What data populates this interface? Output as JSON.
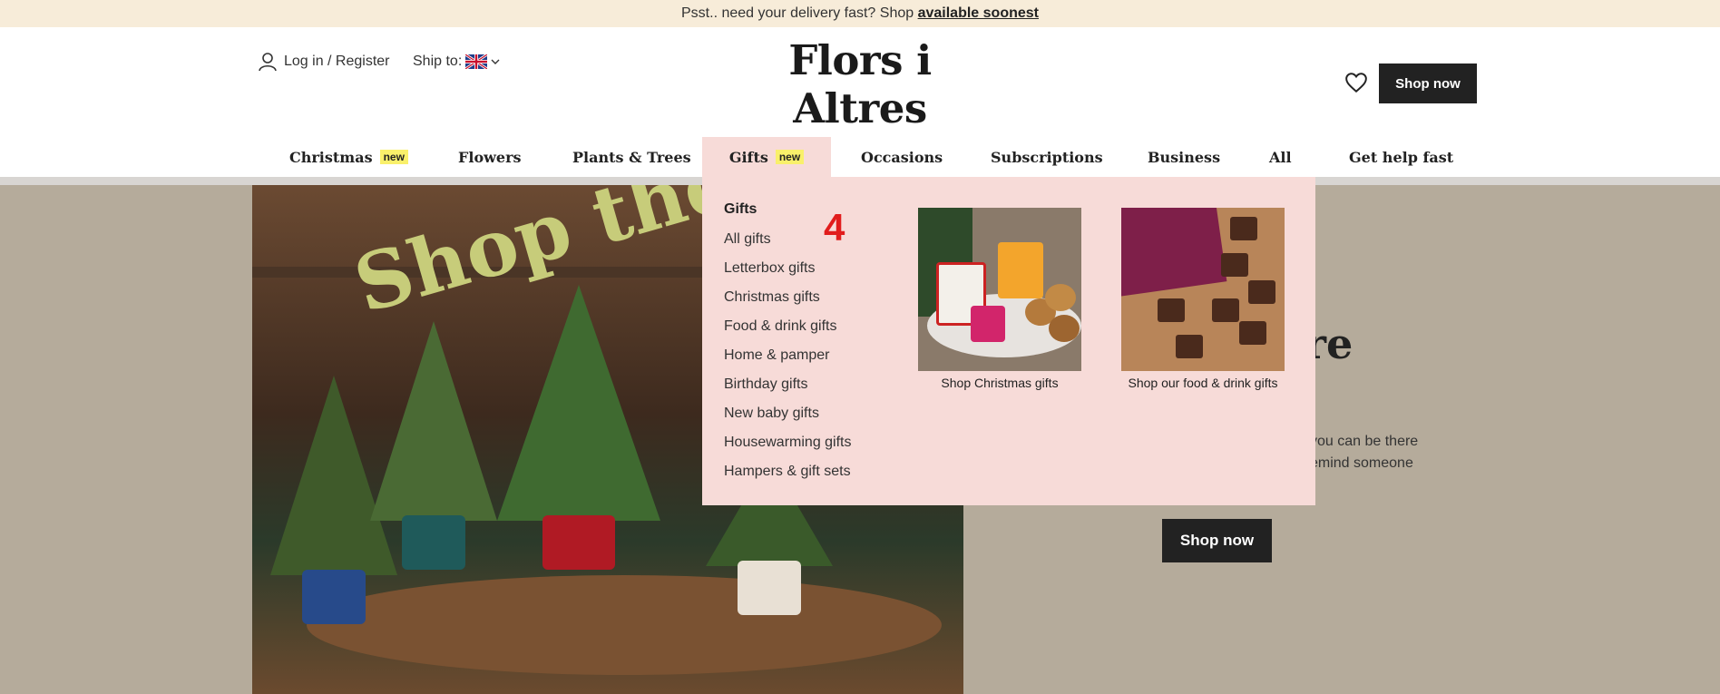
{
  "promo": {
    "text": "Psst.. need your delivery fast? Shop ",
    "link": "available soonest"
  },
  "header": {
    "account_label": "Log in / Register",
    "ship_label": "Ship to:",
    "logo": "Flors i Altres",
    "cta_label": "Shop now"
  },
  "nav": {
    "items": [
      {
        "label": "Christmas",
        "badge": "new"
      },
      {
        "label": "Flowers",
        "badge": ""
      },
      {
        "label": "Plants & Trees",
        "badge": ""
      },
      {
        "label": "Gifts",
        "badge": "new",
        "active": true
      },
      {
        "label": "Occasions",
        "badge": ""
      },
      {
        "label": "Subscriptions",
        "badge": ""
      },
      {
        "label": "Business",
        "badge": ""
      },
      {
        "label": "All",
        "badge": ""
      },
      {
        "label": "Get help fast",
        "badge": ""
      }
    ]
  },
  "dropdown": {
    "heading": "Gifts",
    "marker": "4",
    "links": [
      "All gifts",
      "Letterbox gifts",
      "Christmas gifts",
      "Food & drink gifts",
      "Home & pamper",
      "Birthday gifts",
      "New baby gifts",
      "Housewarming gifts",
      "Hampers & gift sets"
    ],
    "cards": [
      {
        "caption": "Shop Christmas gifts"
      },
      {
        "caption": "Shop our food & drink gifts"
      }
    ]
  },
  "hero": {
    "image_text": "Shop the",
    "title_fragment": "are",
    "desc_line_1": "you can be there",
    "desc_line_2": "emind someone",
    "cta_label": "Shop now"
  },
  "colors": {
    "promo_bg": "#f7ecd9",
    "dropdown_bg": "#f7dbd8",
    "hero_bg": "#b5ab9b",
    "badge_bg": "#f9f06b",
    "button_bg": "#222222",
    "marker": "#e11d1d"
  },
  "icons": {
    "account": "user-icon",
    "flag": "uk-flag-icon",
    "chevron": "chevron-down-icon",
    "wishlist": "heart-icon"
  }
}
